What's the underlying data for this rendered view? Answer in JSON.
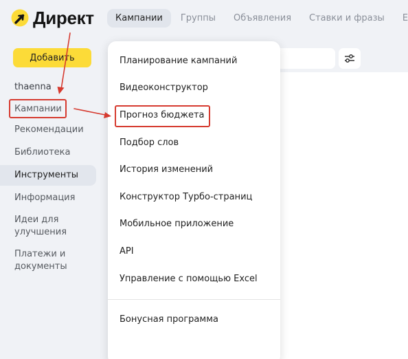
{
  "app": {
    "logo_text": "Директ"
  },
  "topnav": {
    "tabs": [
      "Кампании",
      "Группы",
      "Объявления",
      "Ставки и фразы",
      "Ещё"
    ]
  },
  "sidebar": {
    "add_button": "Добавить",
    "user": "thaenna",
    "items": [
      "Кампании",
      "Рекомендации",
      "Библиотека",
      "Инструменты",
      "Информация",
      "Идеи для улучшения",
      "Платежи и документы"
    ],
    "active_item": "Инструменты"
  },
  "dropdown": {
    "items": [
      "Планирование кампаний",
      "Видеоконструктор",
      "Прогноз бюджета",
      "Подбор слов",
      "История изменений",
      "Конструктор Турбо-страниц",
      "Мобильное приложение",
      "API",
      "Управление с помощью Excel"
    ],
    "bonus": "Бонусная программа"
  },
  "colors": {
    "accent_yellow": "#fcdb38",
    "annotation_red": "#d63a2f",
    "page_bg": "#f0f2f6"
  }
}
